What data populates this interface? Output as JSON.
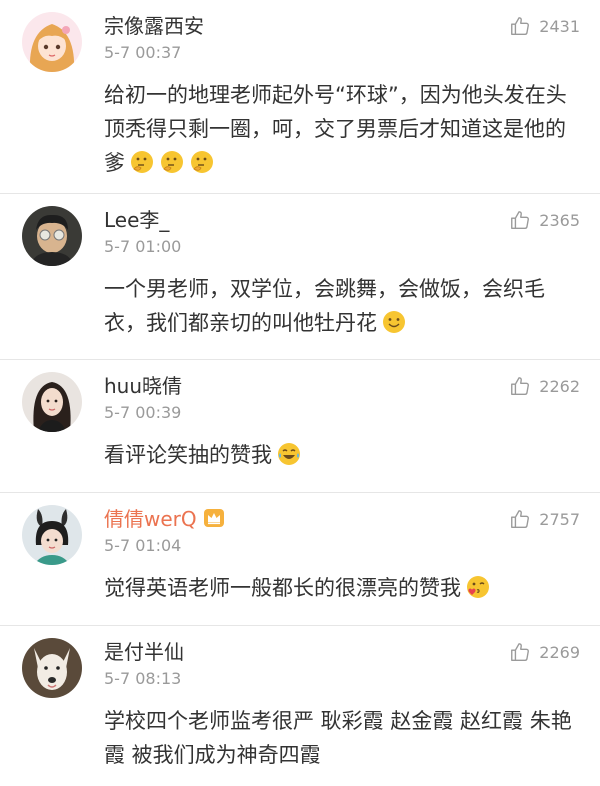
{
  "comments": [
    {
      "username": "宗像露西安",
      "timestamp": "5-7 00:37",
      "likes": "2431",
      "text": "给初一的地理老师起外号“环球”，因为他头发在头顶秃得只剩一圈，呵，交了男票后才知道这是他的爹",
      "emojis": [
        "thinking-emoji",
        "thinking-emoji",
        "thinking-emoji"
      ]
    },
    {
      "username": "Lee李_",
      "timestamp": "5-7 01:00",
      "likes": "2365",
      "text": "一个男老师，双学位，会跳舞，会做饭，会织毛衣，我们都亲切的叫他牡丹花",
      "emojis": [
        "smile-emoji"
      ]
    },
    {
      "username": "huu晓倩",
      "timestamp": "5-7 00:39",
      "likes": "2262",
      "text": "看评论笑抽的赞我",
      "emojis": [
        "laugh-cry-emoji"
      ]
    },
    {
      "username": "倩倩werQ",
      "timestamp": "5-7 01:04",
      "likes": "2757",
      "text": "觉得英语老师一般都长的很漂亮的赞我",
      "emojis": [
        "heart-kiss-emoji"
      ],
      "vip_badge": "crown-icon"
    },
    {
      "username": "是付半仙",
      "timestamp": "5-7 08:13",
      "likes": "2269",
      "text": "学校四个老师监考很严 耿彩霞 赵金霞 赵红霞 朱艳霞 被我们成为神奇四霞",
      "emojis": []
    }
  ],
  "colors": {
    "username": "#333333",
    "vip_username": "#eb7350",
    "meta": "#9a9a9a",
    "divider": "#e6e6e6",
    "emoji": "#f7c531"
  }
}
